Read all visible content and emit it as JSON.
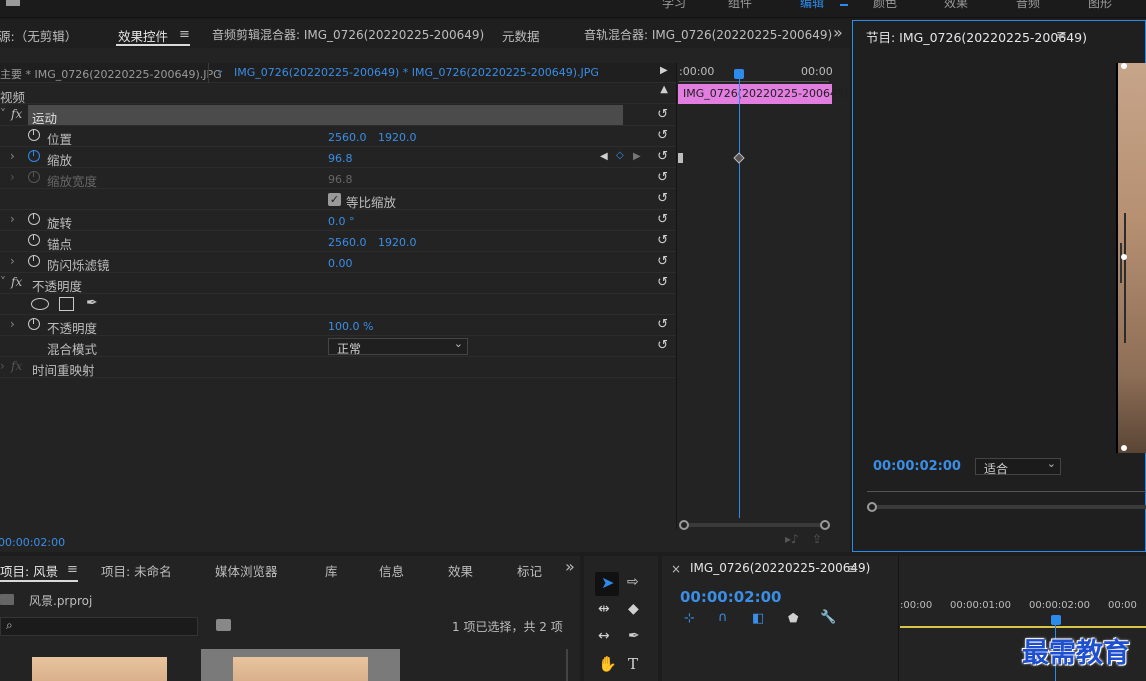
{
  "topbar": {
    "tabs": [
      "学习",
      "组件",
      "编辑",
      "颜色",
      "效果",
      "音频",
      "图形"
    ],
    "active_index": 2
  },
  "source_panel": {
    "tabs": [
      "源:（无剪辑）",
      "效果控件",
      "音频剪辑混合器: IMG_0726(20220225-200649)",
      "元数据",
      "音轨混合器: IMG_0726(20220225-200649)"
    ],
    "active_tab": "效果控件",
    "overflow": "»",
    "menu_glyph": "≡"
  },
  "effect_controls": {
    "master_clip": "主要 * IMG_0726(20220225-200649).JPG",
    "sequence_clip": "IMG_0726(20220225-200649) * IMG_0726(20220225-200649).JPG",
    "section_video": "视频",
    "motion": "运动",
    "position_label": "位置",
    "position_x": "2560.0",
    "position_y": "1920.0",
    "scale_label": "缩放",
    "scale_value": "96.8",
    "scale_width_label": "缩放宽度",
    "scale_width_value": "96.8",
    "uniform_scale_label": "等比缩放",
    "uniform_scale_checked": true,
    "rotation_label": "旋转",
    "rotation_value": "0.0 °",
    "anchor_label": "锚点",
    "anchor_x": "2560.0",
    "anchor_y": "1920.0",
    "antiflicker_label": "防闪烁滤镜",
    "antiflicker_value": "0.00",
    "opacity_group": "不透明度",
    "opacity_label": "不透明度",
    "opacity_value": "100.0 %",
    "blend_label": "混合模式",
    "blend_value": "正常",
    "time_remap": "时间重映射",
    "timecode": "00:00:02:00",
    "timeline_ruler_start": ":00:00",
    "timeline_ruler_end": "00:00",
    "clip_label": "IMG_0726(20220225-200649)"
  },
  "program_monitor": {
    "title": "节目: IMG_0726(20220225-200649)",
    "menu_glyph": "≡",
    "timecode": "00:00:02:00",
    "fit_value": "适合"
  },
  "project_panel": {
    "tabs": [
      "项目: 风景",
      "项目: 未命名",
      "媒体浏览器",
      "库",
      "信息",
      "效果",
      "标记"
    ],
    "active_tab": "项目: 风景",
    "overflow": "»",
    "project_file": "风景.prproj",
    "search_placeholder": "",
    "selection_status": "1 项已选择，共 2 项"
  },
  "timeline_panel": {
    "close_glyph": "×",
    "title": "IMG_0726(20220225-200649)",
    "menu_glyph": "≡",
    "timecode": "00:00:02:00",
    "ruler": [
      ":00:00",
      "00:00:01:00",
      "00:00:02:00",
      "00:00"
    ]
  },
  "watermark": "最需教育",
  "colors": {
    "accent_blue": "#2d8ceb",
    "clip_pink": "#e27ee0",
    "panel_bg": "#232323"
  }
}
